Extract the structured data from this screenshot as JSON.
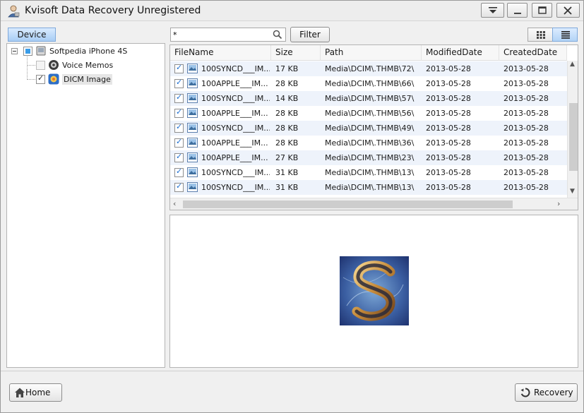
{
  "window": {
    "title": "Kvisoft Data Recovery Unregistered"
  },
  "sidebar": {
    "tab_label": "Device",
    "tree": {
      "root": {
        "label": "Softpedia iPhone 4S",
        "state": "partial"
      },
      "children": [
        {
          "label": "Voice Memos",
          "checked": false,
          "icon": "voice-memo-icon"
        },
        {
          "label": "DICM Image",
          "checked": true,
          "icon": "photos-icon",
          "selected": true
        }
      ]
    }
  },
  "toolbar": {
    "search_value": "*",
    "filter_label": "Filter",
    "view_modes": [
      "grid-view",
      "list-view"
    ],
    "active_view": "list-view"
  },
  "table": {
    "columns": [
      "FileName",
      "Size",
      "Path",
      "ModifiedDate",
      "CreatedDate"
    ],
    "rows": [
      {
        "checked": true,
        "name": "100SYNCD___IM...",
        "size": "17 KB",
        "path": "Media\\DCIM\\.THMB\\72\\",
        "modified": "2013-05-28",
        "created": "2013-05-28"
      },
      {
        "checked": true,
        "name": "100APPLE___IM...",
        "size": "28 KB",
        "path": "Media\\DCIM\\.THMB\\66\\",
        "modified": "2013-05-28",
        "created": "2013-05-28"
      },
      {
        "checked": true,
        "name": "100SYNCD___IM...",
        "size": "14 KB",
        "path": "Media\\DCIM\\.THMB\\57\\",
        "modified": "2013-05-28",
        "created": "2013-05-28"
      },
      {
        "checked": true,
        "name": "100APPLE___IM...",
        "size": "28 KB",
        "path": "Media\\DCIM\\.THMB\\56\\",
        "modified": "2013-05-28",
        "created": "2013-05-28"
      },
      {
        "checked": true,
        "name": "100SYNCD___IM...",
        "size": "28 KB",
        "path": "Media\\DCIM\\.THMB\\49\\",
        "modified": "2013-05-28",
        "created": "2013-05-28"
      },
      {
        "checked": true,
        "name": "100APPLE___IM...",
        "size": "28 KB",
        "path": "Media\\DCIM\\.THMB\\36\\",
        "modified": "2013-05-28",
        "created": "2013-05-28"
      },
      {
        "checked": true,
        "name": "100APPLE___IM...",
        "size": "27 KB",
        "path": "Media\\DCIM\\.THMB\\23\\",
        "modified": "2013-05-28",
        "created": "2013-05-28"
      },
      {
        "checked": true,
        "name": "100SYNCD___IM...",
        "size": "31 KB",
        "path": "Media\\DCIM\\.THMB\\13\\",
        "modified": "2013-05-28",
        "created": "2013-05-28"
      },
      {
        "checked": true,
        "name": "100SYNCD___IM...",
        "size": "31 KB",
        "path": "Media\\DCIM\\.THMB\\13\\",
        "modified": "2013-05-28",
        "created": "2013-05-28"
      }
    ]
  },
  "preview": {
    "image": "softpedia-s-logo-thumbnail"
  },
  "footer": {
    "home_label": "Home",
    "recovery_label": "Recovery"
  },
  "colors": {
    "accent": "#a8cdf5",
    "row_alt": "#eef3fb",
    "checkbox_check": "#1e6fd0"
  }
}
